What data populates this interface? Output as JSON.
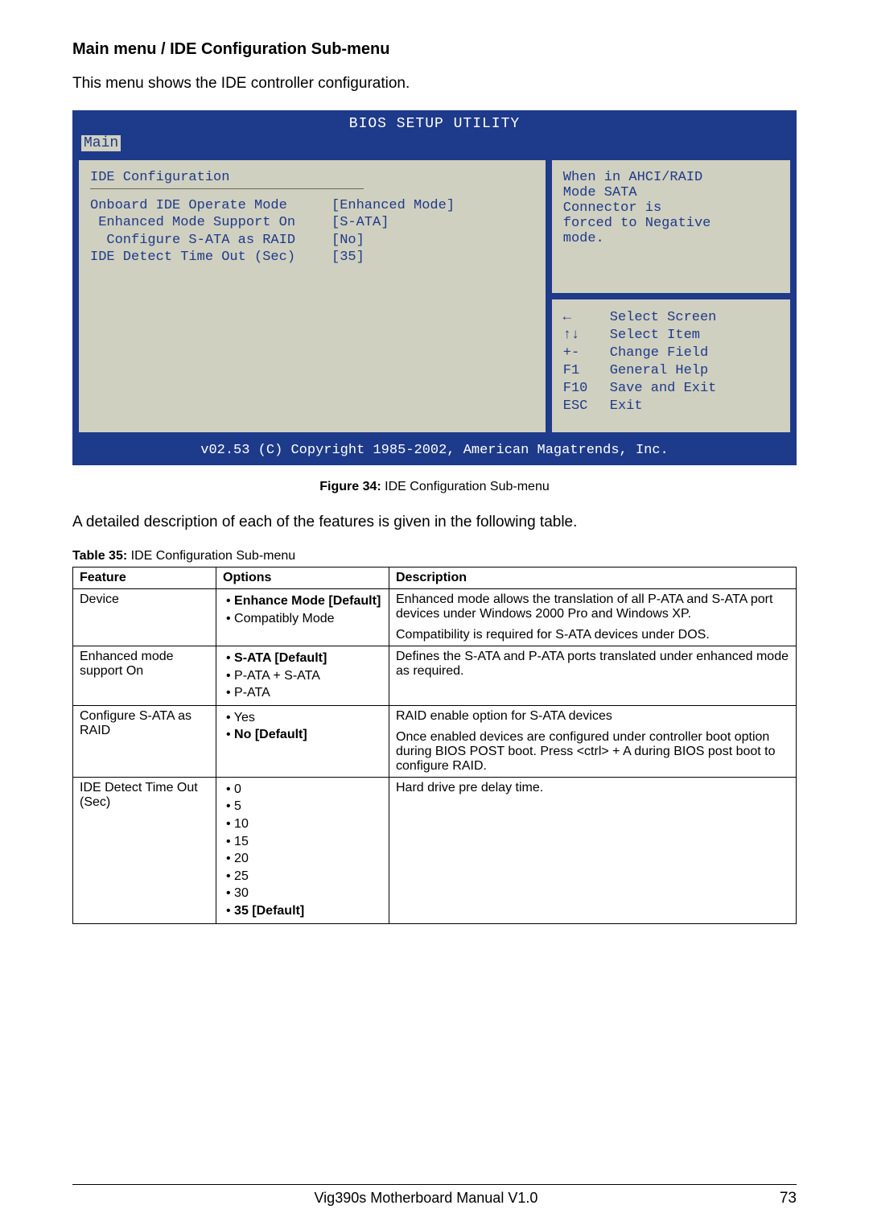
{
  "heading": "Main menu / IDE Configuration Sub-menu",
  "intro": "This menu shows the IDE controller configuration.",
  "bios": {
    "title": "BIOS SETUP UTILITY",
    "tab": "Main",
    "panel_title": "IDE Configuration",
    "settings": [
      {
        "label": "Onboard IDE Operate Mode",
        "value": "[Enhanced Mode]",
        "indent": 0
      },
      {
        "label": "Enhanced Mode Support On",
        "value": "[S-ATA]",
        "indent": 1
      },
      {
        "label": "Configure S-ATA as RAID",
        "value": "[No]",
        "indent": 2
      },
      {
        "label": "IDE Detect Time Out (Sec)",
        "value": "[35]",
        "indent": 0
      }
    ],
    "help_top": [
      "When in AHCI/RAID",
      "Mode SATA",
      "Connector is",
      "forced to Negative",
      "mode."
    ],
    "nav": [
      {
        "key": "←",
        "label": "Select Screen"
      },
      {
        "key": "↑↓",
        "label": "Select Item"
      },
      {
        "key": "+-",
        "label": " Change Field"
      },
      {
        "key": "F1",
        "label": "General Help"
      },
      {
        "key": "F10",
        "label": "Save and Exit"
      },
      {
        "key": "ESC",
        "label": "Exit"
      }
    ],
    "footer": "v02.53 (C) Copyright 1985-2002, American Magatrends, Inc."
  },
  "figure_caption_bold": "Figure 34:",
  "figure_caption_rest": " IDE Configuration Sub-menu",
  "description_line": "A detailed description of each of the features is given in the following table.",
  "table_caption_bold": "Table 35:",
  "table_caption_rest": " IDE Configuration Sub-menu",
  "table": {
    "headers": [
      "Feature",
      "Options",
      "Description"
    ],
    "rows": [
      {
        "feature": "Device",
        "options_html": [
          {
            "t": "Enhance Mode [Default]",
            "b": true
          },
          {
            "t": "Compatibly Mode",
            "b": false
          }
        ],
        "desc": [
          "Enhanced mode allows the translation of all P-ATA and S-ATA port devices under Windows 2000 Pro and Windows XP.",
          "Compatibility is required for S-ATA devices under DOS."
        ]
      },
      {
        "feature": "Enhanced mode support On",
        "options_html": [
          {
            "t": "S-ATA [Default]",
            "b": true
          },
          {
            "t": "P-ATA + S-ATA",
            "b": false
          },
          {
            "t": "P-ATA",
            "b": false
          }
        ],
        "desc": [
          "Defines the S-ATA and P-ATA ports translated under enhanced mode as required."
        ]
      },
      {
        "feature": "Configure S-ATA as RAID",
        "options_html": [
          {
            "t": "Yes",
            "b": false
          },
          {
            "t": "No [Default]",
            "b": true
          }
        ],
        "desc": [
          "RAID enable option for S-ATA devices",
          "Once enabled devices are configured under controller boot option during BIOS POST boot. Press <ctrl> + A during BIOS post boot to configure RAID."
        ]
      },
      {
        "feature": "IDE Detect Time Out (Sec)",
        "options_html": [
          {
            "t": "0",
            "b": false
          },
          {
            "t": "5",
            "b": false
          },
          {
            "t": "10",
            "b": false
          },
          {
            "t": "15",
            "b": false
          },
          {
            "t": "20",
            "b": false
          },
          {
            "t": "25",
            "b": false
          },
          {
            "t": "30",
            "b": false
          },
          {
            "t": "35 [Default]",
            "b": true
          }
        ],
        "desc": [
          "Hard drive pre delay time."
        ]
      }
    ]
  },
  "footer": {
    "center": "Vig390s Motherboard Manual V1.0",
    "page": "73"
  }
}
